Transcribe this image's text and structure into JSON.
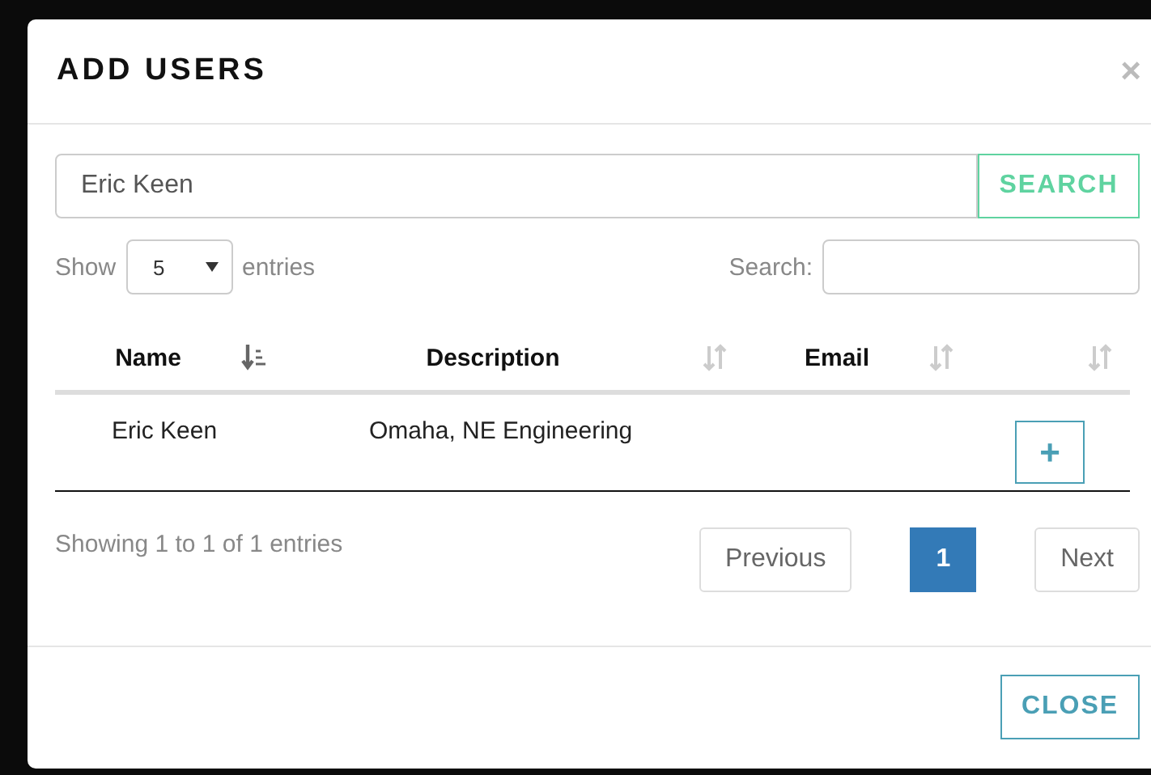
{
  "dialog": {
    "title": "ADD USERS",
    "close_glyph": "×"
  },
  "search_box": {
    "value": "Eric Keen",
    "button": "SEARCH"
  },
  "length": {
    "show_label": "Show",
    "value": "5",
    "entries_label": "entries"
  },
  "filter": {
    "label": "Search:"
  },
  "table": {
    "columns": [
      {
        "label": "Name",
        "sorted": true
      },
      {
        "label": "Description",
        "sorted": false
      },
      {
        "label": "Email",
        "sorted": false
      },
      {
        "sorted": false
      }
    ],
    "rows": [
      {
        "name": "Eric Keen",
        "description": "Omaha, NE Engineering",
        "action": "+"
      }
    ]
  },
  "info": "Showing 1 to 1 of 1 entries",
  "pagination": [
    {
      "label": "Previous",
      "kind": "nav",
      "selected": false
    },
    {
      "label": "1",
      "kind": "page",
      "selected": true
    },
    {
      "label": "Next",
      "kind": "nav",
      "selected": false
    }
  ],
  "footer": {
    "button": "CLOSE"
  }
}
